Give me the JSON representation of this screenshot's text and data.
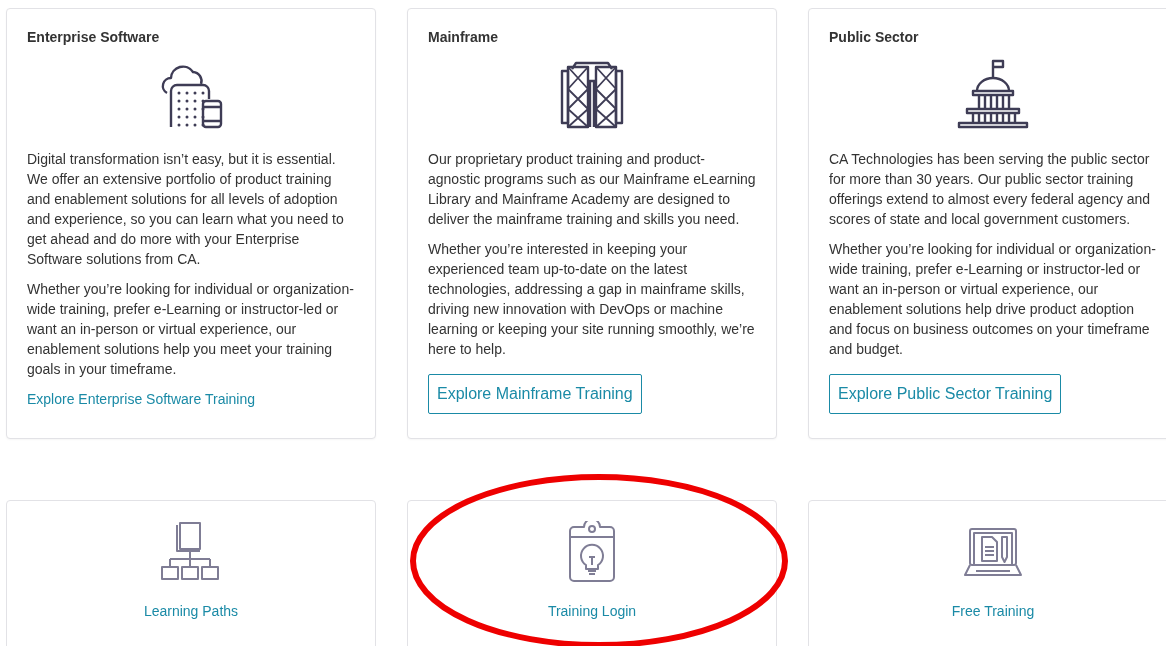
{
  "cards": [
    {
      "title": "Enterprise Software",
      "paragraphs": [
        "Digital transformation isn’t easy, but it is essential. We offer an extensive portfolio of product training and enablement solutions for all levels of adoption and experience, so you can learn what you need to get ahead and do more with your Enterprise Software solutions from CA.",
        "Whether you’re looking for individual or organization-wide training, prefer e-Learning or instructor-led or want an in-person or virtual experience, our enablement solutions help you meet your training goals in your timeframe."
      ],
      "action": {
        "kind": "link",
        "label": "Explore Enterprise Software Training"
      }
    },
    {
      "title": "Mainframe",
      "paragraphs": [
        "Our proprietary product training and product-agnostic programs such as our Mainframe eLearning Library and Mainframe Academy are designed to deliver the mainframe training and skills you need.",
        "Whether you’re interested in keeping your experienced team up-to-date on the latest technologies, addressing a gap in mainframe skills, driving new innovation with DevOps or machine learning or keeping your site running smoothly, we’re here to help."
      ],
      "action": {
        "kind": "button",
        "label": "Explore Mainframe Training"
      }
    },
    {
      "title": "Public Sector",
      "paragraphs": [
        "CA Technologies has been serving the public sector for more than 30 years. Our public sector training offerings extend to almost every federal agency and scores of state and local government customers.",
        "Whether you’re looking for individual or organization-wide training, prefer e-Learning or instructor-led or want an in-person or virtual experience, our enablement solutions help drive product adoption and focus on business outcomes on your timeframe and budget."
      ],
      "action": {
        "kind": "button",
        "label": "Explore Public Sector Training"
      }
    }
  ],
  "quick_links": [
    {
      "label": "Learning Paths",
      "circled": false
    },
    {
      "label": "Training Login",
      "circled": true
    },
    {
      "label": "Free Training",
      "circled": false
    }
  ]
}
